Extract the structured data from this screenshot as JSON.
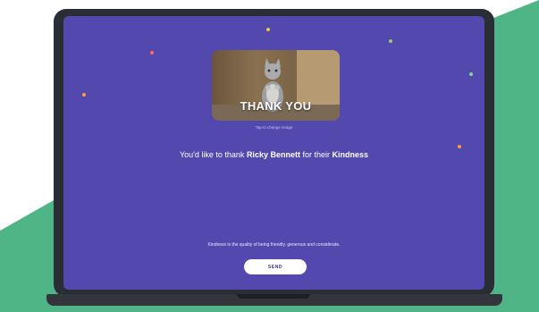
{
  "colors": {
    "screen_bg": "#5248ad",
    "accent_green": "#4fb586",
    "laptop_frame": "#2b2d35",
    "button_bg": "#ffffff"
  },
  "card": {
    "title": "THANK YOU",
    "tap_hint": "Tap to change image"
  },
  "message": {
    "prefix": "You'd like to thank ",
    "recipient": "Ricky Bennett",
    "middle": " for their ",
    "value": "Kindness"
  },
  "definition": "Kindness is the quality of being friendly, generous and considerate.",
  "send_label": "SEND"
}
